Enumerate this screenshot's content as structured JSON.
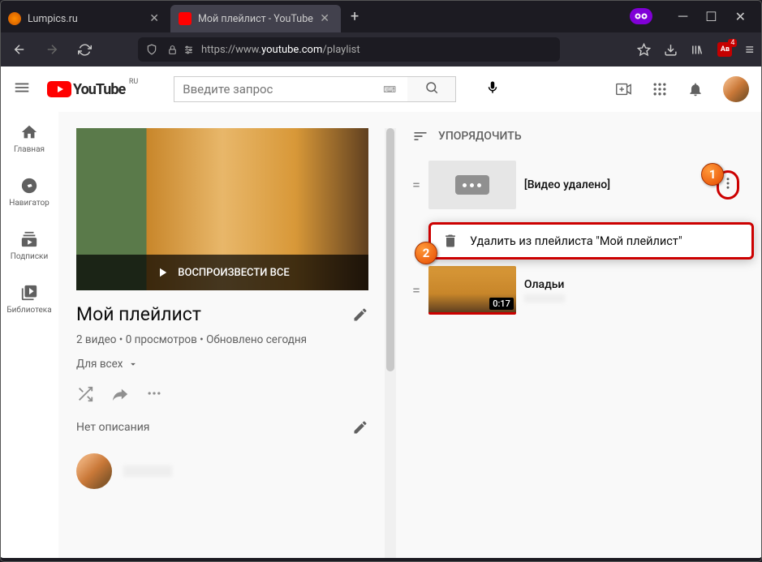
{
  "browser": {
    "tabs": [
      {
        "title": "Lumpics.ru",
        "active": false
      },
      {
        "title": "Мой плейлист - YouTube",
        "active": true
      }
    ],
    "url_prefix": "https://www.",
    "url_domain": "youtube.com",
    "url_path": "/playlist",
    "ext_badge": "4"
  },
  "header": {
    "logo_text": "YouTube",
    "logo_cc": "RU",
    "search_placeholder": "Введите запрос"
  },
  "sidebar": {
    "items": [
      {
        "label": "Главная"
      },
      {
        "label": "Навигатор"
      },
      {
        "label": "Подписки"
      },
      {
        "label": "Библиотека"
      }
    ]
  },
  "playlist": {
    "play_all": "ВОСПРОИЗВЕСТИ ВСЕ",
    "title": "Мой плейлист",
    "meta": "2 видео • 0 просмотров • Обновлено сегодня",
    "visibility": "Для всех",
    "no_description": "Нет описания"
  },
  "right": {
    "sort_label": "УПОРЯДОЧИТЬ",
    "videos": [
      {
        "title": "[Видео удалено]",
        "deleted": true
      },
      {
        "title": "Оладьи",
        "duration": "0:17"
      }
    ],
    "popup": "Удалить из плейлиста \"Мой плейлист\""
  },
  "callouts": {
    "one": "1",
    "two": "2"
  }
}
